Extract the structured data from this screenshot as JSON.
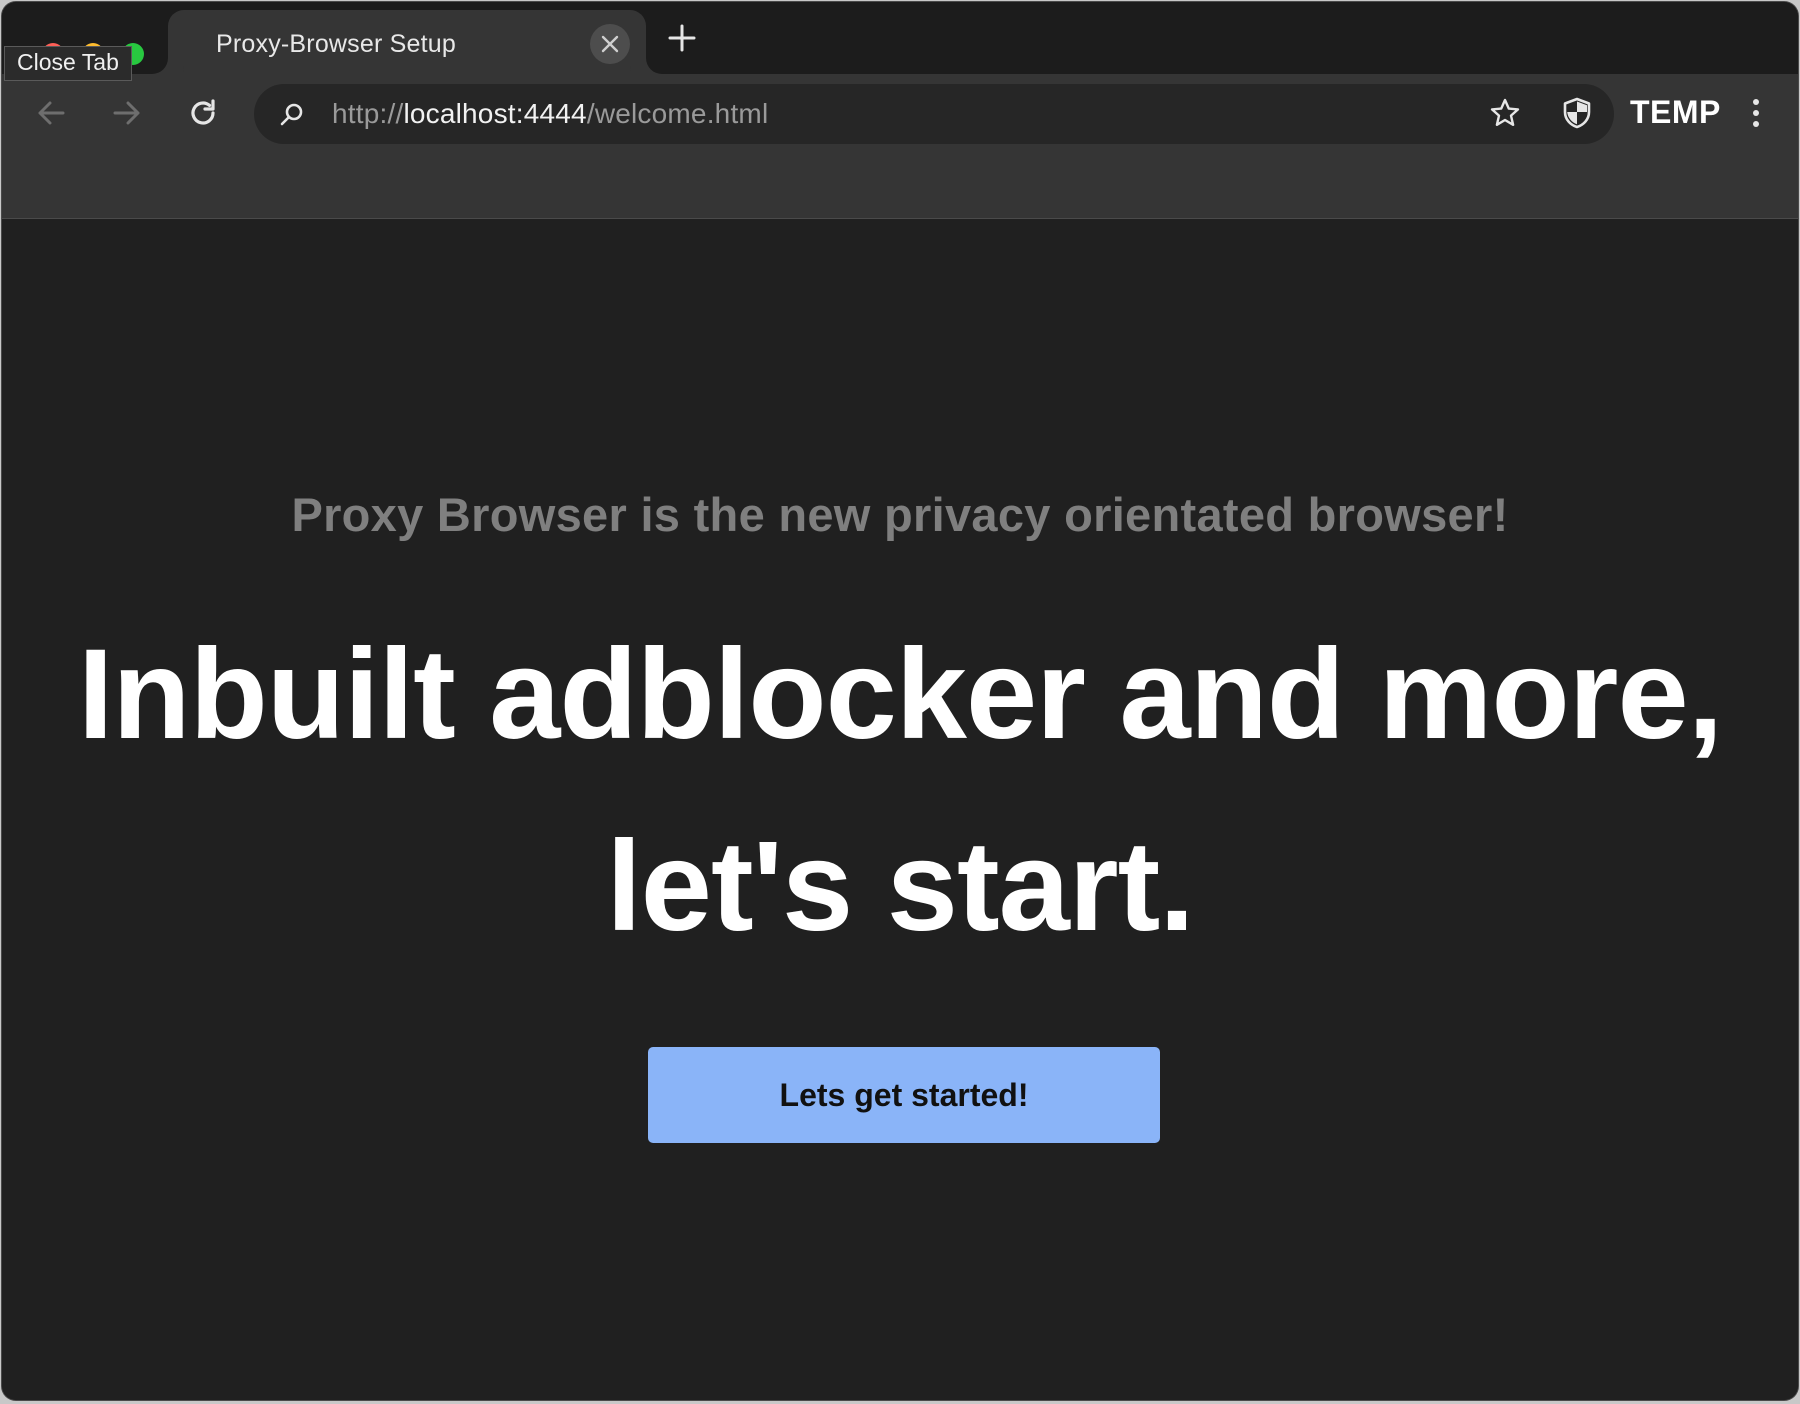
{
  "window": {
    "traffic_lights": [
      "close",
      "minimize",
      "zoom"
    ]
  },
  "tabs": [
    {
      "title": "Proxy-Browser Setup",
      "active": true
    }
  ],
  "tooltip": "Close Tab",
  "toolbar": {
    "url_scheme": "http://",
    "url_host": "localhost:4444",
    "url_path": "/welcome.html",
    "profile_label": "TEMP"
  },
  "icons": {
    "back": "arrow-left-icon",
    "forward": "arrow-right-icon",
    "reload": "reload-icon",
    "search": "search-icon",
    "bookmark": "star-icon",
    "shield": "shield-icon",
    "menu": "kebab-menu-icon",
    "tab_close": "close-icon",
    "new_tab": "plus-icon"
  },
  "page": {
    "tagline": "Proxy Browser is the new privacy orientated browser!",
    "headline": "Inbuilt adblocker and more, let's start.",
    "cta_label": "Lets get started!"
  },
  "colors": {
    "page_bg": "#202020",
    "toolbar_bg": "#353535",
    "tabstrip_bg": "#1c1c1c",
    "cta_bg": "#8ab4f8",
    "tagline": "#7f7f7f"
  }
}
